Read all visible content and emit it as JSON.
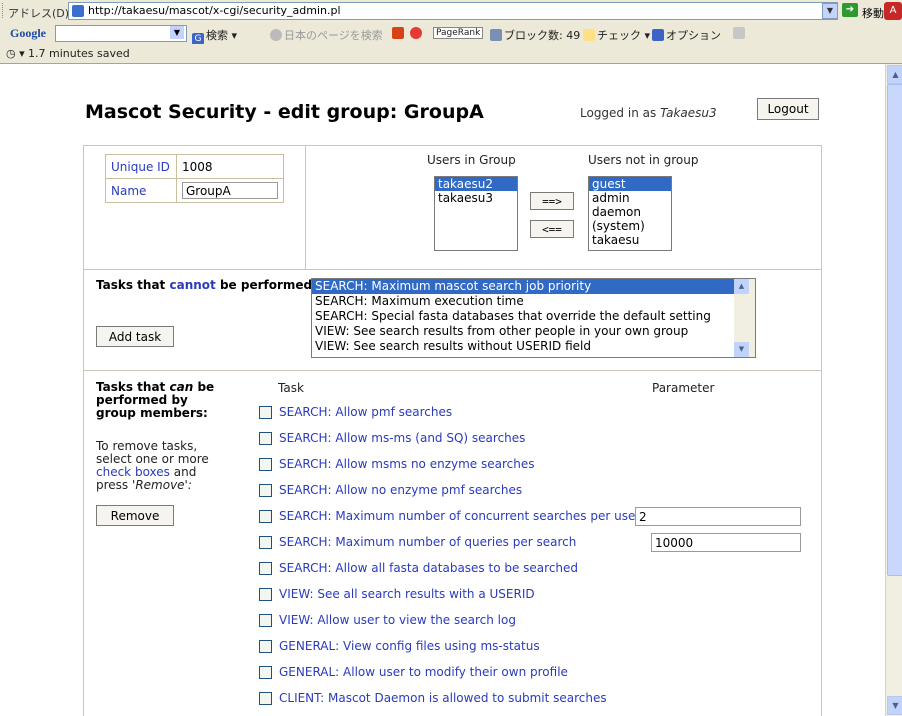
{
  "browser": {
    "address_label": "アドレス(D)",
    "url": "http://takaesu/mascot/x-cgi/security_admin.pl",
    "go_label": "移動",
    "google_toolbar": {
      "logo": "Google",
      "search_label": "検索",
      "japanese_pages_label": "日本のページを検索",
      "pagerank_label": "PageRank",
      "block_count_label": "ブロック数: 49",
      "check_label": "チェック",
      "options_label": "オプション"
    },
    "saved_status": "1.7 minutes saved"
  },
  "page": {
    "title": "Mascot Security - edit group: GroupA",
    "logged_in_prefix": "Logged in as",
    "logged_in_user": "Takaesu3",
    "logout_label": "Logout"
  },
  "group": {
    "unique_id_label": "Unique ID",
    "unique_id": "1008",
    "name_label": "Name",
    "name": "GroupA"
  },
  "users": {
    "in_group_heading": "Users in Group",
    "not_in_group_heading": "Users not in group",
    "in_group": [
      "takaesu2",
      "takaesu3"
    ],
    "not_in_group": [
      "guest",
      "admin",
      "daemon",
      "(system)",
      "takaesu"
    ],
    "add_button": "==>",
    "remove_button": "<=="
  },
  "cannot": {
    "label_prefix": "Tasks that",
    "label_word": "cannot",
    "label_suffix": "be performed by group members:",
    "add_task_label": "Add task",
    "options": [
      "SEARCH: Maximum mascot search job priority",
      "SEARCH: Maximum execution time",
      "SEARCH: Special fasta databases that override the default setting",
      "VIEW: See search results from other people in your own group",
      "VIEW: See search results without USERID field"
    ]
  },
  "can": {
    "label_prefix": "Tasks that",
    "label_word": "can",
    "label_suffix": "be performed by group members:",
    "instr_1": "To remove tasks, select one or more",
    "instr_link": "check boxes",
    "instr_2": "and press",
    "instr_remove": "'Remove':",
    "remove_label": "Remove",
    "col_task": "Task",
    "col_param": "Parameter",
    "tasks": [
      {
        "name": "SEARCH: Allow pmf searches",
        "param": null
      },
      {
        "name": "SEARCH: Allow ms-ms (and SQ) searches",
        "param": null
      },
      {
        "name": "SEARCH: Allow msms no enzyme searches",
        "param": null
      },
      {
        "name": "SEARCH: Allow no enzyme pmf searches",
        "param": null
      },
      {
        "name": "SEARCH: Maximum number of concurrent searches per user",
        "param": "2"
      },
      {
        "name": "SEARCH: Maximum number of queries per search",
        "param": "10000"
      },
      {
        "name": "SEARCH: Allow all fasta databases to be searched",
        "param": null
      },
      {
        "name": "VIEW: See all search results with a USERID",
        "param": null
      },
      {
        "name": "VIEW: Allow user to view the search log",
        "param": null
      },
      {
        "name": "GENERAL: View config files using ms-status",
        "param": null
      },
      {
        "name": "GENERAL: Allow user to modify their own profile",
        "param": null
      },
      {
        "name": "CLIENT: Mascot Daemon is allowed to submit searches",
        "param": null
      }
    ]
  }
}
